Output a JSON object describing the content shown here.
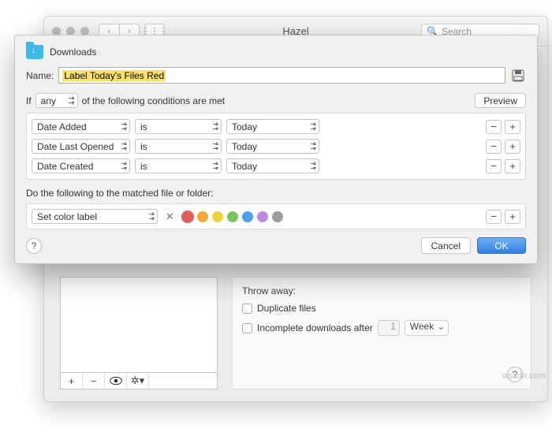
{
  "bg": {
    "title": "Hazel",
    "search_placeholder": "Search",
    "throw_away_label": "Throw away:",
    "dup_label": "Duplicate files",
    "incomplete_label": "Incomplete downloads after",
    "incomplete_value": "1",
    "incomplete_unit": "Week"
  },
  "sheet": {
    "folder": "Downloads",
    "name_label": "Name:",
    "rule_name": "Label Today's Files Red",
    "if_prefix": "If",
    "if_mode": "any",
    "if_suffix": "of the following conditions are met",
    "preview": "Preview",
    "rules": [
      {
        "attr": "Date Added",
        "op": "is",
        "val": "Today"
      },
      {
        "attr": "Date Last Opened",
        "op": "is",
        "val": "Today"
      },
      {
        "attr": "Date Created",
        "op": "is",
        "val": "Today"
      }
    ],
    "action_label": "Do the following to the matched file or folder:",
    "action": "Set color label",
    "cancel": "Cancel",
    "ok": "OK"
  },
  "watermark": "wsxdn.com"
}
